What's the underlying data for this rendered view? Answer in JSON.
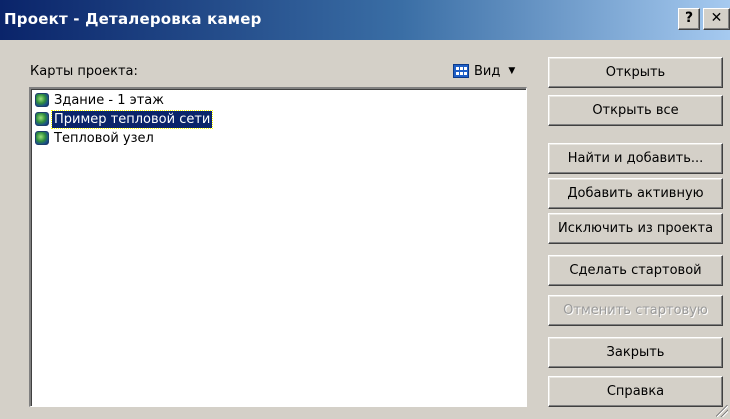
{
  "window": {
    "title": "Проект - Деталеровка камер",
    "help_label": "?",
    "close_label": "✕"
  },
  "list": {
    "label": "Карты проекта:",
    "view_label": "Вид",
    "items": [
      {
        "label": "Здание - 1 этаж",
        "selected": false,
        "icon": "map-icon"
      },
      {
        "label": "Пример тепловой сети",
        "selected": true,
        "icon": "map-icon"
      },
      {
        "label": "Тепловой узел",
        "selected": false,
        "icon": "map-icon"
      }
    ]
  },
  "buttons": {
    "open": "Открыть",
    "open_all": "Открыть все",
    "find_add": "Найти и добавить...",
    "add_active": "Добавить активную",
    "exclude": "Исключить из проекта",
    "make_start": "Сделать стартовой",
    "cancel_start": "Отменить стартовую",
    "close": "Закрыть",
    "help": "Справка"
  },
  "colors": {
    "title_gradient_start": "#0a246a",
    "title_gradient_end": "#a6caf0",
    "selection": "#0a246a",
    "dialog_bg": "#d4d0c8"
  }
}
